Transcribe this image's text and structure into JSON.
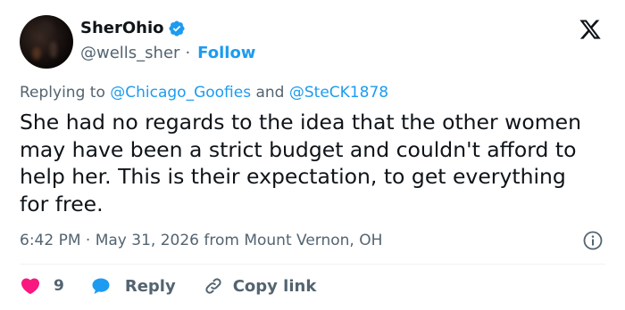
{
  "author": {
    "display_name": "SherOhio",
    "handle": "@wells_sher",
    "separator": "·",
    "follow_label": "Follow",
    "verified": true
  },
  "reply_context": {
    "prefix": "Replying to",
    "mention_1": "@Chicago_Goofies",
    "conjunction": "and",
    "mention_2": "@SteCK1878"
  },
  "tweet": {
    "text": "She had no regards to the idea that the other women may have been a strict budget and couldn't afford to help her. This is their expectation, to get everything for free.",
    "timestamp": "6:42 PM · May 31, 2026 from Mount Vernon, OH"
  },
  "actions": {
    "like_count": "9",
    "reply_label": "Reply",
    "copy_link_label": "Copy link"
  },
  "colors": {
    "accent": "#1d9bf0",
    "like": "#f91880",
    "text": "#0f1419",
    "secondary": "#536471"
  },
  "icons": [
    "verified-badge-icon",
    "x-logo-icon",
    "info-icon",
    "heart-icon",
    "reply-bubble-icon",
    "link-icon"
  ]
}
